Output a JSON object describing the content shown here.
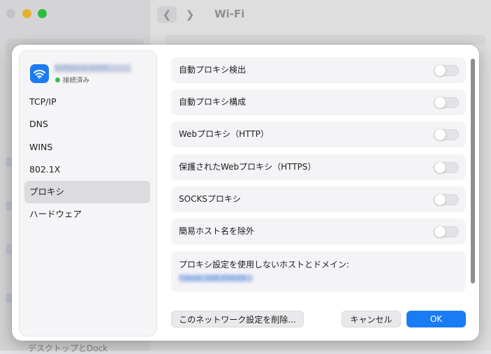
{
  "window": {
    "title": "Wi-Fi",
    "bottom_label": "デスクトップとDock"
  },
  "network": {
    "name": "Buffalo-G-XXXX",
    "status": "接続済み"
  },
  "sidebar": {
    "items": [
      {
        "label": "TCP/IP"
      },
      {
        "label": "DNS"
      },
      {
        "label": "WINS"
      },
      {
        "label": "802.1X"
      },
      {
        "label": "プロキシ"
      },
      {
        "label": "ハードウェア"
      }
    ],
    "selected": "プロキシ"
  },
  "proxy": {
    "options": [
      {
        "label": "自動プロキシ検出",
        "enabled": false
      },
      {
        "label": "自動プロキシ構成",
        "enabled": false
      },
      {
        "label": "Webプロキシ（HTTP）",
        "enabled": false
      },
      {
        "label": "保護されたWebプロキシ（HTTPS）",
        "enabled": false
      },
      {
        "label": "SOCKSプロキシ",
        "enabled": false
      },
      {
        "label": "簡易ホスト名を除外",
        "enabled": false
      }
    ],
    "bypass_label": "プロキシ設定を使用しないホストとドメイン:",
    "bypass_value": "*.local, 169.254/16"
  },
  "buttons": {
    "delete": "このネットワーク設定を削除...",
    "cancel": "キャンセル",
    "ok": "OK"
  },
  "colors": {
    "accent": "#1a7cf5",
    "status_green": "#30c048"
  },
  "icons": {
    "network": "wifi-icon"
  }
}
